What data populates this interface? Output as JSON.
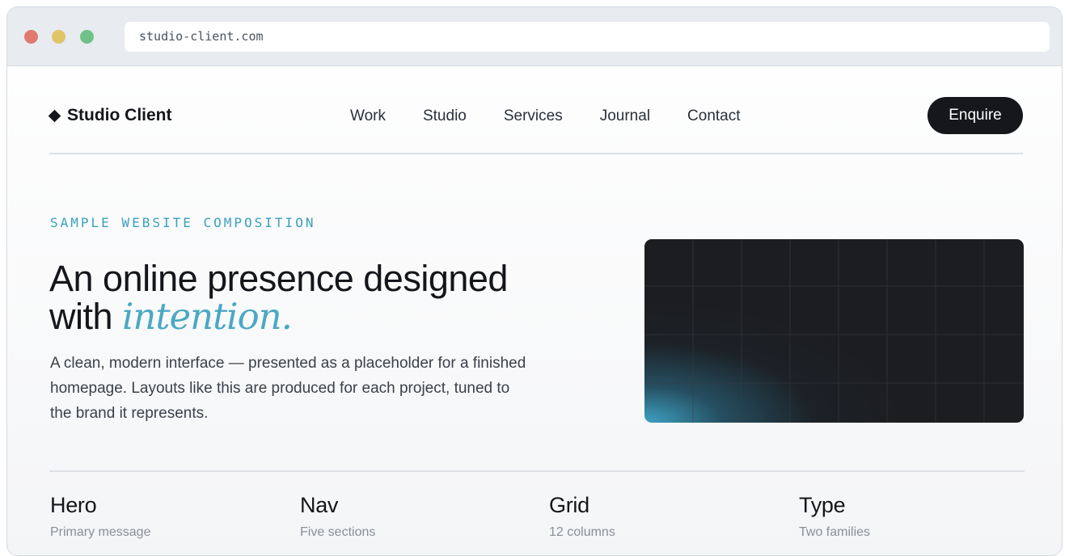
{
  "browser": {
    "url": "studio-client.com"
  },
  "site": {
    "brand": "Studio Client",
    "nav": [
      "Work",
      "Studio",
      "Services",
      "Journal",
      "Contact"
    ],
    "cta": "Enquire"
  },
  "hero": {
    "eyebrow": "SAMPLE WEBSITE COMPOSITION",
    "headline_line1": "An online presence designed",
    "headline_with": "with ",
    "headline_accent": "intention.",
    "lead": "A clean, modern interface — presented as a placeholder for a finished homepage. Layouts like this are produced for each project, tuned to the brand it represents."
  },
  "features": [
    {
      "title": "Hero",
      "subtitle": "Primary message"
    },
    {
      "title": "Nav",
      "subtitle": "Five sections"
    },
    {
      "title": "Grid",
      "subtitle": "12 columns"
    },
    {
      "title": "Type",
      "subtitle": "Two families"
    }
  ],
  "colors": {
    "accent": "#4aa8c4",
    "dark": "#15171b",
    "dot_red": "#e07a6e",
    "dot_yellow": "#e0c468",
    "dot_green": "#6fc287"
  }
}
